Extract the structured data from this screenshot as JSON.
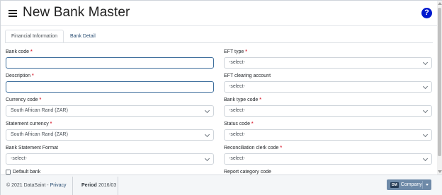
{
  "header": {
    "title": "New Bank Master",
    "menu_icon": "hamburger-menu-icon",
    "help_icon": "question-circle-icon",
    "help_glyph": "?",
    "help_color": "#0019ce"
  },
  "tabs": [
    {
      "label": "Financial Information",
      "active": true
    },
    {
      "label": "Bank Detail",
      "active": false
    }
  ],
  "left_fields": {
    "bank_code": {
      "label": "Bank code",
      "required": true,
      "value": ""
    },
    "description": {
      "label": "Description",
      "required": true,
      "value": ""
    },
    "currency_code": {
      "label": "Currency code",
      "required": true,
      "value": "South African Rand (ZAR)"
    },
    "statement_currency": {
      "label": "Statement currency",
      "required": true,
      "value": "South African Rand (ZAR)"
    },
    "bank_statement_format": {
      "label": "Bank Statement Format",
      "required": false,
      "value": "-select-"
    },
    "default_bank": {
      "label": "Default bank",
      "checked": false
    }
  },
  "right_fields": {
    "eft_type": {
      "label": "EFT type",
      "required": true,
      "value": "-select-"
    },
    "eft_clearing_account": {
      "label": "EFT clearing account",
      "required": false,
      "value": "-select-"
    },
    "bank_type_code": {
      "label": "Bank type code",
      "required": true,
      "value": "-select-"
    },
    "status_code": {
      "label": "Status code",
      "required": true,
      "value": "-select-"
    },
    "reconciliation_clerk_code": {
      "label": "Reconciliation clerk code",
      "required": true,
      "value": "-select-"
    },
    "report_category_code": {
      "label": "Report category code",
      "required": false
    }
  },
  "required_marker": "*",
  "footer": {
    "copyright": "© 2021 DataSaint - ",
    "privacy": "Privacy",
    "period_label": "Period",
    "period_value": "2016/03",
    "company_badge": "DM",
    "company_label": "Company"
  },
  "colors": {
    "required": "#dc3545",
    "link": "#2b4f74",
    "company_button": "#6e8aa8"
  }
}
